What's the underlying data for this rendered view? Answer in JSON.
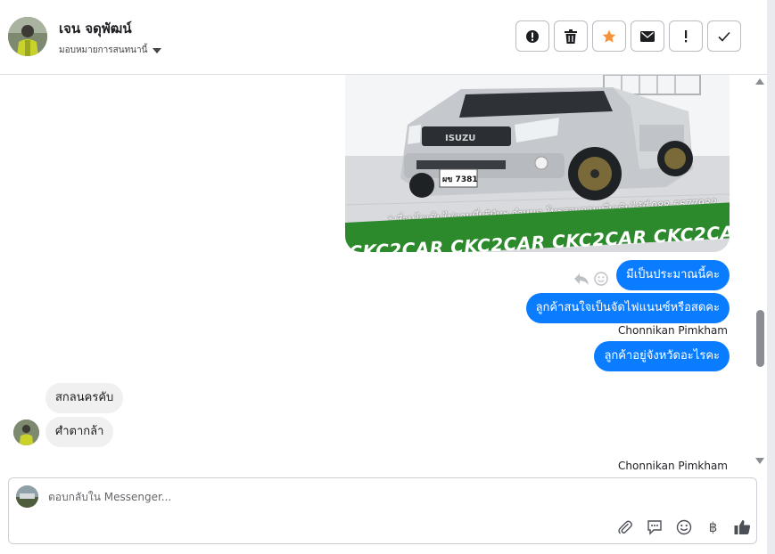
{
  "header": {
    "contact_name": "เจน จดุพัฒน์",
    "assign_label": "มอบหมายการสนทนานี้",
    "actions": [
      {
        "icon": "alert-circle-icon"
      },
      {
        "icon": "trash-icon"
      },
      {
        "icon": "star-icon"
      },
      {
        "icon": "envelope-icon"
      },
      {
        "icon": "exclamation-icon"
      },
      {
        "icon": "checkmark-icon"
      }
    ]
  },
  "conversation": {
    "image": {
      "caption": "*เงื่อนไขเป็นไปตามที่บริษัทฯ กำหนด โทรสอบถามเพิ่มเติมได้ที่ 088-5577932",
      "banner": "CKC2CAR CKC2CAR CKC2CAR CKC2CAR CKC2",
      "plate": "ผข 7381",
      "brand": "ISUZU"
    },
    "outgoing": [
      {
        "text": "มีเป็นประมาณนี้คะ"
      },
      {
        "text": "ลูกค้าสนใจเป็นจัดไฟแนนซ์หรือสดคะ"
      },
      {
        "text": "ลูกค้าอยู่จังหวัดอะไรคะ"
      }
    ],
    "sender_labels": [
      "Chonnikan Pimkham",
      "Chonnikan Pimkham"
    ],
    "incoming": [
      {
        "text": "สกลนครคับ"
      },
      {
        "text": "ศำตากล้า"
      }
    ]
  },
  "composer": {
    "placeholder": "ตอบกลับใน Messenger...",
    "tools": [
      "paperclip-icon",
      "speech-bubble-icon",
      "smiley-icon",
      "baht-icon",
      "thumbs-up-icon"
    ],
    "baht_symbol": "฿"
  },
  "colors": {
    "accent": "#0a7cff",
    "star": "#f7923a",
    "incoming_bubble": "#f0f0f0",
    "banner_green": "#2c8a2c"
  }
}
